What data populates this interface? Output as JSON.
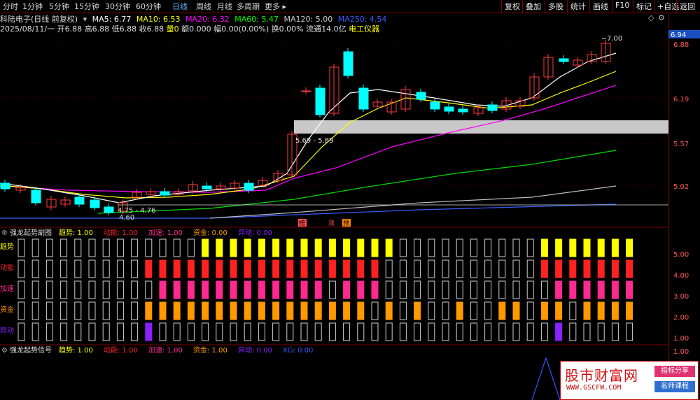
{
  "toolbar": {
    "periods": [
      "分时",
      "1分钟",
      "5分钟",
      "15分钟",
      "30分钟",
      "60分钟",
      "日线",
      "周线",
      "月线",
      "多周期",
      "更多 ▸"
    ],
    "active_period": "日线",
    "right_buttons": [
      "复权",
      "叠加",
      "多股",
      "统计",
      "画线",
      "F10",
      "标记",
      "+自选",
      "返回"
    ]
  },
  "info": {
    "title": "科陆电子(日线 前复权)",
    "ma5": "MA5: 6.77",
    "ma10": "MA10: 6.53",
    "ma20": "MA20: 6.32",
    "ma60": "MA60: 5.47",
    "ma120": "MA120: 5.00",
    "ma250": "MA250: 4.54",
    "diamond_icon": "◇"
  },
  "ohlc": {
    "date": "2025/08/11/一",
    "open": "开6.88",
    "high": "高6.88",
    "low": "低6.88",
    "close": "收6.88",
    "vol": "量0",
    "amount": "额0.000",
    "change": "幅0.00(0.00%)",
    "turnover": "换0.00%",
    "float": "流通14.0亿",
    "sector": "电工仪器"
  },
  "price_axis": {
    "current": "6.94",
    "ticks": [
      "6.88",
      "6.19",
      "5.57",
      "5.02"
    ]
  },
  "main_chart": {
    "high_label": "7.00",
    "low_label": "4.60",
    "range_label1": "4.75 - 4.76",
    "range_label2": "5.69 - 5.89",
    "markers": [
      "榜",
      "涨",
      "预"
    ]
  },
  "sub1": {
    "title": "强龙起势副图",
    "legend": [
      {
        "name": "趋势: 1.00",
        "color": "#ffff00"
      },
      {
        "name": "动能: 1.00",
        "color": "#ff2222"
      },
      {
        "name": "加速: 1.00",
        "color": "#ff2a90"
      },
      {
        "name": "资金: 0.00",
        "color": "#ff9900"
      },
      {
        "name": "异动: 0.00",
        "color": "#8822ff"
      }
    ],
    "row_labels": [
      {
        "name": "趋势",
        "color": "#ffff00"
      },
      {
        "name": "动能",
        "color": "#ff2222"
      },
      {
        "name": "加速",
        "color": "#ff2a90"
      },
      {
        "name": "资金",
        "color": "#ff9900"
      },
      {
        "name": "异动",
        "color": "#8822ff"
      }
    ],
    "axis": [
      "5.00",
      "4.00",
      "3.00",
      "2.00",
      "1.00"
    ]
  },
  "sub2": {
    "title": "强龙起势信号",
    "legend": [
      {
        "name": "趋势: 1.00",
        "color": "#ffff00"
      },
      {
        "name": "动能: 1.00",
        "color": "#ff2222"
      },
      {
        "name": "加速: 1.00",
        "color": "#ff2a90"
      },
      {
        "name": "资金: 1.00",
        "color": "#ff9900"
      },
      {
        "name": "异动: 0.00",
        "color": "#8822ff"
      },
      {
        "name": "XG: 0.00",
        "color": "#3355ff"
      }
    ],
    "axis": [
      "1.00"
    ]
  },
  "watermark": {
    "brand": "股市财富网",
    "url": "WWW.GSCFW.COM",
    "tag1": "指标分享",
    "tag2": "名师课程"
  },
  "colors": {
    "up": "#ff3c3c",
    "down": "#00ffff",
    "ma5": "#ffffff",
    "ma10": "#ffff00",
    "ma20": "#ff00ff",
    "ma60": "#00ff00",
    "ma120": "#bbbbbb",
    "ma250": "#0000ff"
  }
}
